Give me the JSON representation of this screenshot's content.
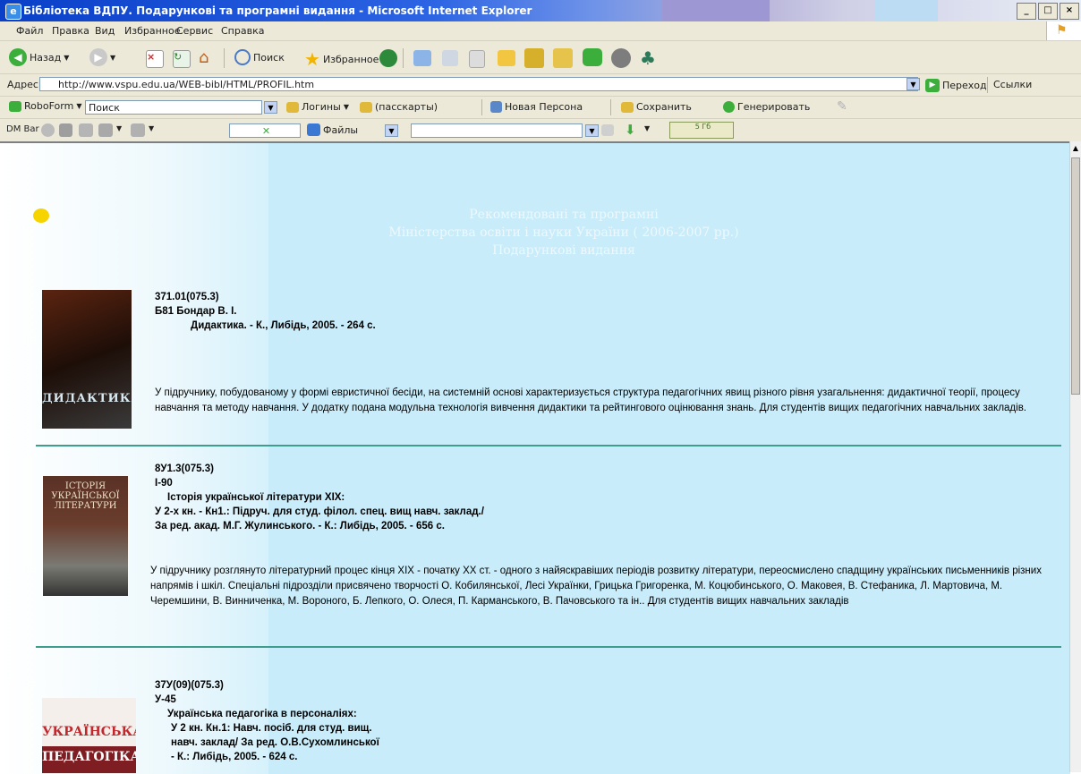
{
  "window": {
    "title": "Бібліотека ВДПУ. Подарункові та програмні видання - Microsoft Internet Explorer",
    "controls": [
      "_",
      "□",
      "×"
    ]
  },
  "menu": [
    "Файл",
    "Правка",
    "Вид",
    "Избранное",
    "Сервис",
    "Справка"
  ],
  "toolbar": {
    "back": "Назад",
    "search": "Поиск",
    "favorites": "Избранное"
  },
  "address": {
    "label": "Адрес:",
    "url": "http://www.vspu.edu.ua/WEB-bibl/HTML/PROFIL.htm",
    "go": "Переход",
    "links": "Ссылки"
  },
  "roboform": {
    "name": "RoboForm",
    "search_value": "Поиск",
    "logins": "Логины",
    "passcards": "(пасскарты)",
    "new_persona": "Новая Персона",
    "save": "Сохранить",
    "generate": "Генерировать"
  },
  "dmbar": {
    "name": "DM Bar",
    "files": "Файлы",
    "size": "5 Гб"
  },
  "page": {
    "heading": [
      "Рекомендовані та програмні",
      "Міністерства освіти і науки України ( 2006-2007 рр.)",
      "Подарункові видання"
    ],
    "books": [
      {
        "cover_text": "ДИДАКТИКА",
        "code": "371.01(075.3)",
        "lines": [
          "Б81    Бондар В. І.",
          "Дидактика. - К., Либідь, 2005. - 264  с."
        ],
        "desc": "У підручнику, побудованому у формі евристичної бесіди, на системній основі характеризується структура педагогічних явищ різного рівня узагальнення: дидактичної теорії, процесу навчання та методу навчання. У додатку подана модульна технологія вивчення дидактики та рейтингового оцінювання знань. Для студентів вищих педагогічних навчальних закладів."
      },
      {
        "cover_text": "ІСТОРІЯ УКРАЇНСЬКОЇ ЛІТЕРАТУРИ",
        "code": "8У1.3(075.3)",
        "lines": [
          "І-90",
          "Історія української літератури ХІХ:",
          "У 2-х кн. - Кн1.: Підруч. для студ. філол. спец. вищ навч. заклад./",
          "За ред. акад. М.Г. Жулинського. - К.: Либідь, 2005. - 656 с."
        ],
        "desc": "У підручнику розглянуто літературний процес кінця ХІХ - початку ХХ ст. - одного з найяскравіших періодів розвитку літератури, переосмислено спадщину українських письменників різних напрямів і шкіл. Спеціальні підрозділи присвячено творчості О. Кобилянської, Лесі Українки, Грицька Григоренка, М. Коцюбинського, О. Маковея, В. Стефаника, Л. Мартовича, М. Черемшини, В. Винниченка, М. Вороного, Б. Лепкого, О. Олеся, П. Карманського, В. Пачовського та ін.. Для студентів вищих навчальних закладів"
      },
      {
        "cover_text": [
          "УКРАЇНСЬКА",
          "ПЕДАГОГІКА"
        ],
        "code": "37У(09)(075.3)",
        "lines": [
          "У-45",
          "Українська педагогіка в персоналіях:",
          "У 2 кн. Кн.1: Навч. посіб. для студ. вищ.",
          "навч. заклад/ За ред. О.В.Сухомлинської",
          "- К.: Либідь, 2005. - 624  с."
        ]
      }
    ]
  }
}
